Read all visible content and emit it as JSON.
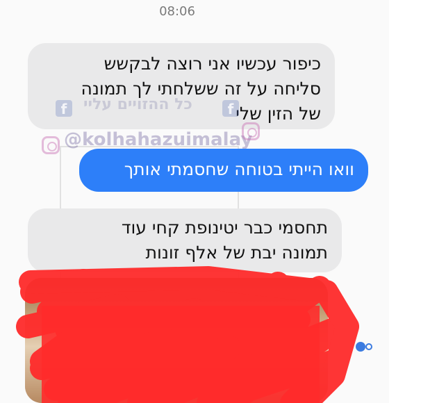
{
  "status": {
    "time": "08:06"
  },
  "watermark": {
    "handle": "@kolhahazuimalay",
    "name": "כל ההזויים עליי"
  },
  "messages": [
    {
      "direction": "incoming",
      "lines": [
        "כיפור עכשיו אני רוצה לבקשש",
        "סליחה על זה ששלחתי לך תמונה",
        "של הזין שלי"
      ]
    },
    {
      "direction": "outgoing",
      "lines": [
        "וואו הייתי בטוחה שחסמתי אותך"
      ]
    },
    {
      "direction": "incoming",
      "lines": [
        "תחסמי כבר יטינופת קחי עוד",
        "תמונה יבת של אלף זונות"
      ]
    },
    {
      "direction": "incoming",
      "type": "photo",
      "censored": true
    }
  ],
  "colors": {
    "outgoing_bubble": "#2d7ff9",
    "incoming_bubble": "#e9e9ea",
    "censor_scribble": "#ff2b2b"
  }
}
